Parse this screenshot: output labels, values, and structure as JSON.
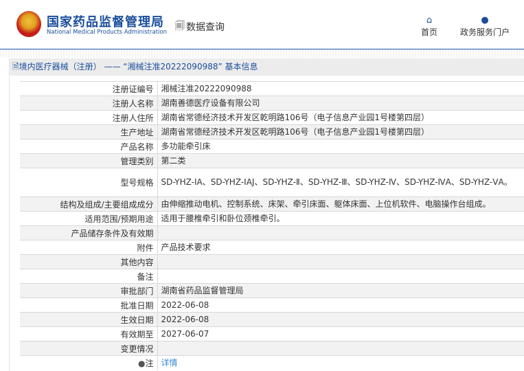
{
  "header": {
    "brand_cn": "国家药品监督管理局",
    "brand_en": "National Medical Products Administration",
    "data_query": "数据查询",
    "nav": [
      {
        "label": "首页",
        "icon": "home-icon"
      },
      {
        "label": "政务服务门户",
        "icon": "user-icon"
      }
    ]
  },
  "panel": {
    "title": "境内医疗器械（注册） —— “湘械注准20222090988” 基本信息"
  },
  "rows": [
    {
      "label": "注册证编号",
      "value": "湘械注准20222090988"
    },
    {
      "label": "注册人名称",
      "value": "湖南善德医疗设备有限公司"
    },
    {
      "label": "注册人住所",
      "value": "湖南省常德经济技术开发区乾明路106号（电子信息产业园1号楼第四层）"
    },
    {
      "label": "生产地址",
      "value": "湖南省常德经济技术开发区乾明路106号（电子信息产业园1号楼第四层）"
    },
    {
      "label": "产品名称",
      "value": "多功能牵引床"
    },
    {
      "label": "管理类别",
      "value": "第二类"
    },
    {
      "label": "型号规格",
      "value": "SD-YHZ-ⅠA、SD-YHZ-ⅠAJ、SD-YHZ-Ⅱ、SD-YHZ-Ⅲ、SD-YHZ-Ⅳ、SD-YHZ-ⅣA、SD-YHZ-ⅤA。"
    },
    {
      "label": "结构及组成/主要组成成分",
      "value": "由伸缩推动电机、控制系统、床架、牵引床面、躯体床面、上位机软件、电脑操作台组成。"
    },
    {
      "label": "适用范围/预期用途",
      "value": "适用于腰椎牵引和卧位颈椎牵引。"
    },
    {
      "label": "产品储存条件及有效期",
      "value": ""
    },
    {
      "label": "附件",
      "value": "产品技术要求"
    },
    {
      "label": "其他内容",
      "value": ""
    },
    {
      "label": "备注",
      "value": ""
    },
    {
      "label": "审批部门",
      "value": "湖南省药品监督管理局"
    },
    {
      "label": "批准日期",
      "value": "2022-06-08"
    },
    {
      "label": "生效日期",
      "value": "2022-06-08"
    },
    {
      "label": "有效期至",
      "value": "2027-06-07"
    },
    {
      "label": "变更情况",
      "value": ""
    }
  ],
  "note": {
    "label": "注",
    "link": "详情"
  }
}
